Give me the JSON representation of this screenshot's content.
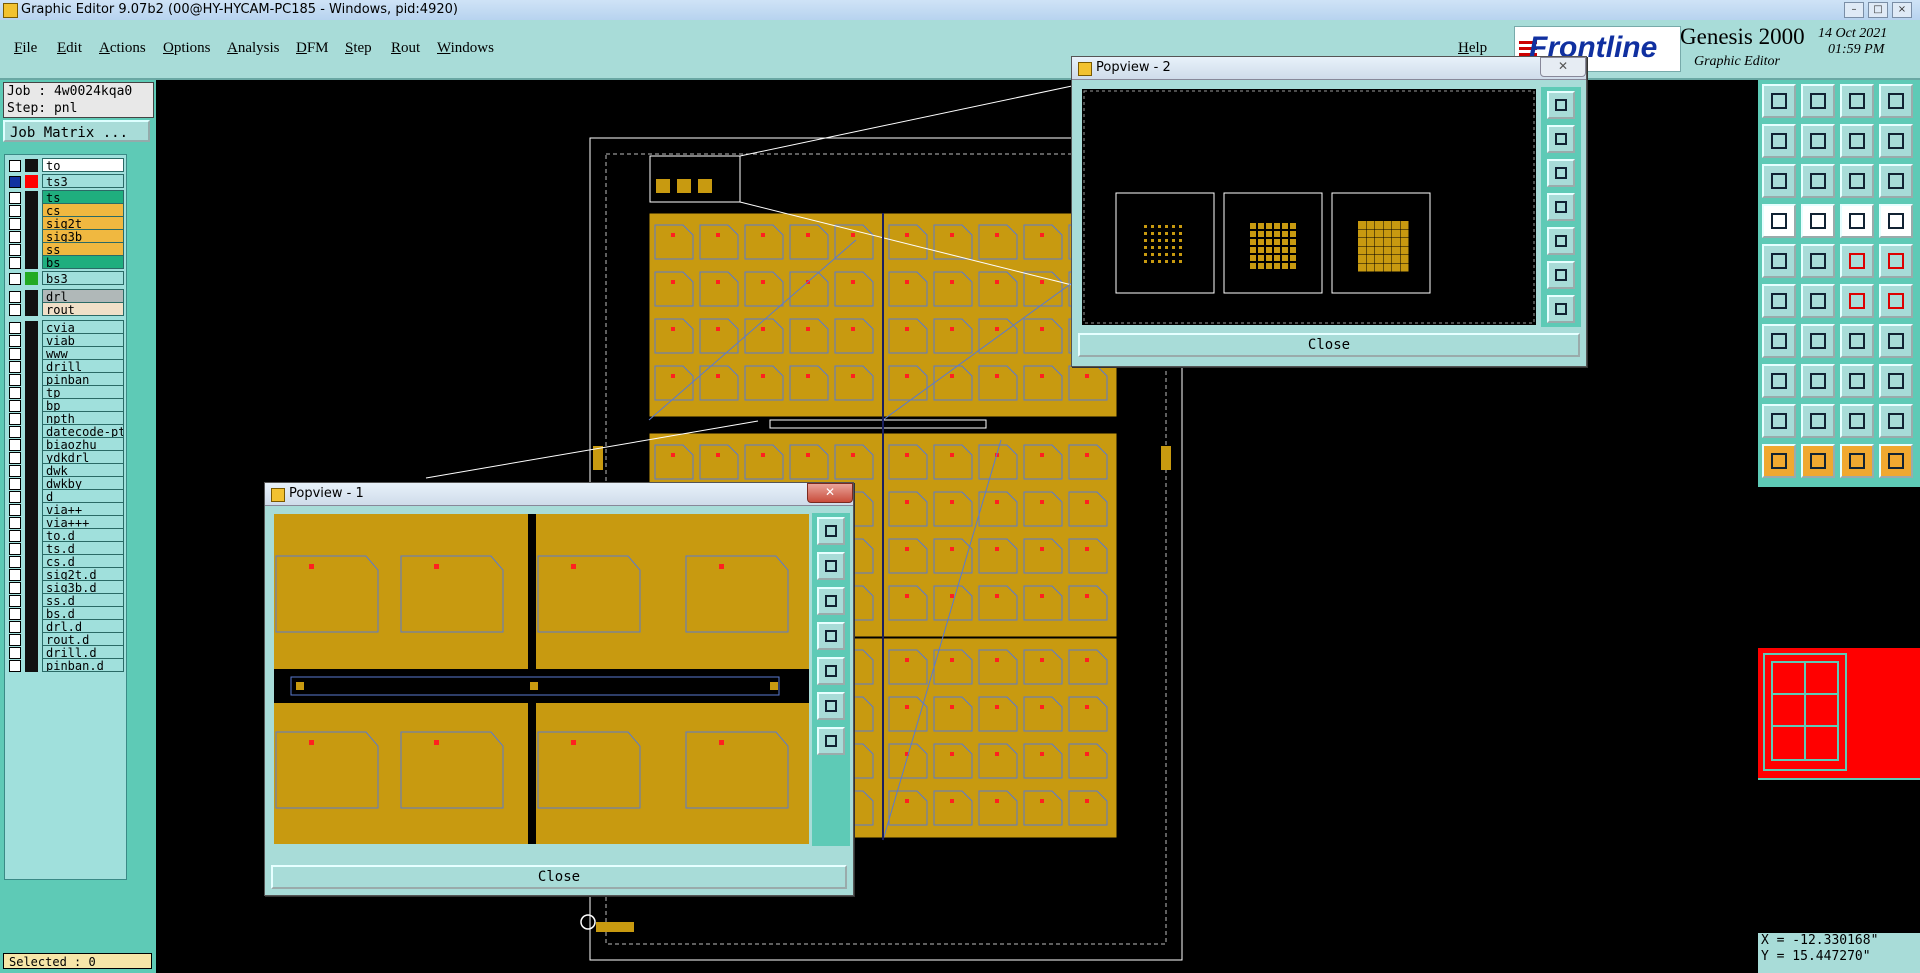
{
  "window": {
    "title": "Graphic Editor 9.07b2 (00@HY-HYCAM-PC185 - Windows, pid:4920)"
  },
  "menu": {
    "items": [
      "File",
      "Edit",
      "Actions",
      "Options",
      "Analysis",
      "DFM",
      "Step",
      "Rout",
      "Windows"
    ],
    "help": "Help"
  },
  "brand": {
    "logo_text": "Frontline",
    "product": "Genesis 2000",
    "subtitle": "Graphic Editor",
    "date": "14 Oct 2021",
    "time": "01:59 PM"
  },
  "job": {
    "job_line": "Job : 4w0024kqa0",
    "step_line": "Step: pnl",
    "matrix_button": "Job Matrix ..."
  },
  "layers": [
    {
      "name": "to",
      "bg": "#ffffff",
      "swatch": "#111111"
    },
    {
      "name": "ts3",
      "bg": "#a0e0dc",
      "swatch": "#ff0000",
      "checked": true
    },
    {
      "name": "ts",
      "bg": "#1fae7e",
      "swatch": "#111111"
    },
    {
      "name": "cs",
      "bg": "#f0b840",
      "swatch": "#111111"
    },
    {
      "name": "sig2t",
      "bg": "#f0b840",
      "swatch": "#111111"
    },
    {
      "name": "sig3b",
      "bg": "#f0b840",
      "swatch": "#111111"
    },
    {
      "name": "ss",
      "bg": "#f0b840",
      "swatch": "#111111"
    },
    {
      "name": "bs",
      "bg": "#1fae7e",
      "swatch": "#111111"
    },
    {
      "name": "bs3",
      "bg": "#a0e0dc",
      "swatch": "#22aa22"
    },
    {
      "name": "drl",
      "bg": "#b0b8b8",
      "swatch": "#111111"
    },
    {
      "name": "rout",
      "bg": "#f0e0c8",
      "swatch": "#111111"
    },
    {
      "name": "cvia",
      "bg": "#a0e0dc",
      "swatch": "#111111"
    },
    {
      "name": "viab",
      "bg": "#a0e0dc",
      "swatch": "#111111"
    },
    {
      "name": "www",
      "bg": "#a0e0dc",
      "swatch": "#111111"
    },
    {
      "name": "drill",
      "bg": "#a0e0dc",
      "swatch": "#111111"
    },
    {
      "name": "pinban",
      "bg": "#a0e0dc",
      "swatch": "#111111"
    },
    {
      "name": "tp",
      "bg": "#a0e0dc",
      "swatch": "#111111"
    },
    {
      "name": "bp",
      "bg": "#a0e0dc",
      "swatch": "#111111"
    },
    {
      "name": "npth",
      "bg": "#a0e0dc",
      "swatch": "#111111"
    },
    {
      "name": "datecode-pt",
      "bg": "#a0e0dc",
      "swatch": "#111111"
    },
    {
      "name": "biaozhu",
      "bg": "#a0e0dc",
      "swatch": "#111111"
    },
    {
      "name": "ydkdrl",
      "bg": "#a0e0dc",
      "swatch": "#111111"
    },
    {
      "name": "dwk",
      "bg": "#a0e0dc",
      "swatch": "#111111"
    },
    {
      "name": "dwkby",
      "bg": "#a0e0dc",
      "swatch": "#111111"
    },
    {
      "name": "d",
      "bg": "#a0e0dc",
      "swatch": "#111111"
    },
    {
      "name": "via++",
      "bg": "#a0e0dc",
      "swatch": "#111111"
    },
    {
      "name": "via+++",
      "bg": "#a0e0dc",
      "swatch": "#111111"
    },
    {
      "name": "to.d",
      "bg": "#a0e0dc",
      "swatch": "#111111"
    },
    {
      "name": "ts.d",
      "bg": "#a0e0dc",
      "swatch": "#111111"
    },
    {
      "name": "cs.d",
      "bg": "#a0e0dc",
      "swatch": "#111111"
    },
    {
      "name": "sig2t.d",
      "bg": "#a0e0dc",
      "swatch": "#111111"
    },
    {
      "name": "sig3b.d",
      "bg": "#a0e0dc",
      "swatch": "#111111"
    },
    {
      "name": "ss.d",
      "bg": "#a0e0dc",
      "swatch": "#111111"
    },
    {
      "name": "bs.d",
      "bg": "#a0e0dc",
      "swatch": "#111111"
    },
    {
      "name": "drl.d",
      "bg": "#a0e0dc",
      "swatch": "#111111"
    },
    {
      "name": "rout.d",
      "bg": "#a0e0dc",
      "swatch": "#111111"
    },
    {
      "name": "drill.d",
      "bg": "#a0e0dc",
      "swatch": "#111111"
    },
    {
      "name": "pinban.d",
      "bg": "#a0e0dc",
      "swatch": "#111111"
    }
  ],
  "status": {
    "selected": "Selected : 0"
  },
  "coords": {
    "x": "X = -12.330168\"",
    "y": "Y = 15.447270\""
  },
  "popup1": {
    "title": "Popview - 1",
    "close_label": "Close"
  },
  "popup2": {
    "title": "Popview - 2",
    "close_label": "Close"
  },
  "colors": {
    "board": "#c89a10",
    "outline": "#5a7ad0",
    "pad": "#ff2020",
    "panel_bg": "#5ecab6",
    "button_bg": "#a8dcd8"
  }
}
